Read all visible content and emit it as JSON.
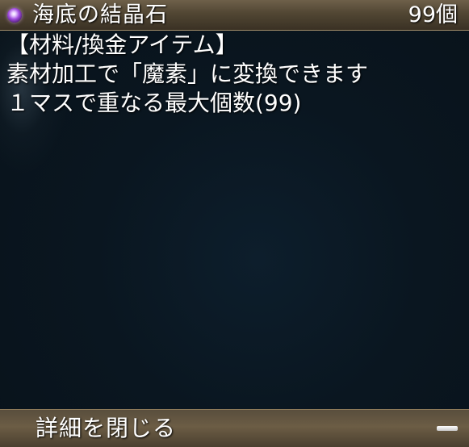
{
  "item": {
    "name": "海底の結晶石",
    "count": "99個",
    "icon": "purple-orb-icon"
  },
  "description": {
    "lines": [
      "【材料/換金アイテム】",
      "素材加工で「魔素」に変換できます",
      "１マスで重なる最大個数(99)"
    ]
  },
  "footer": {
    "close_label": "詳細を閉じる",
    "icon": "minus-icon"
  },
  "colors": {
    "header": "#514633",
    "footer": "#6c5d45",
    "background": "#0b1620",
    "orb": "#a24ddf"
  }
}
